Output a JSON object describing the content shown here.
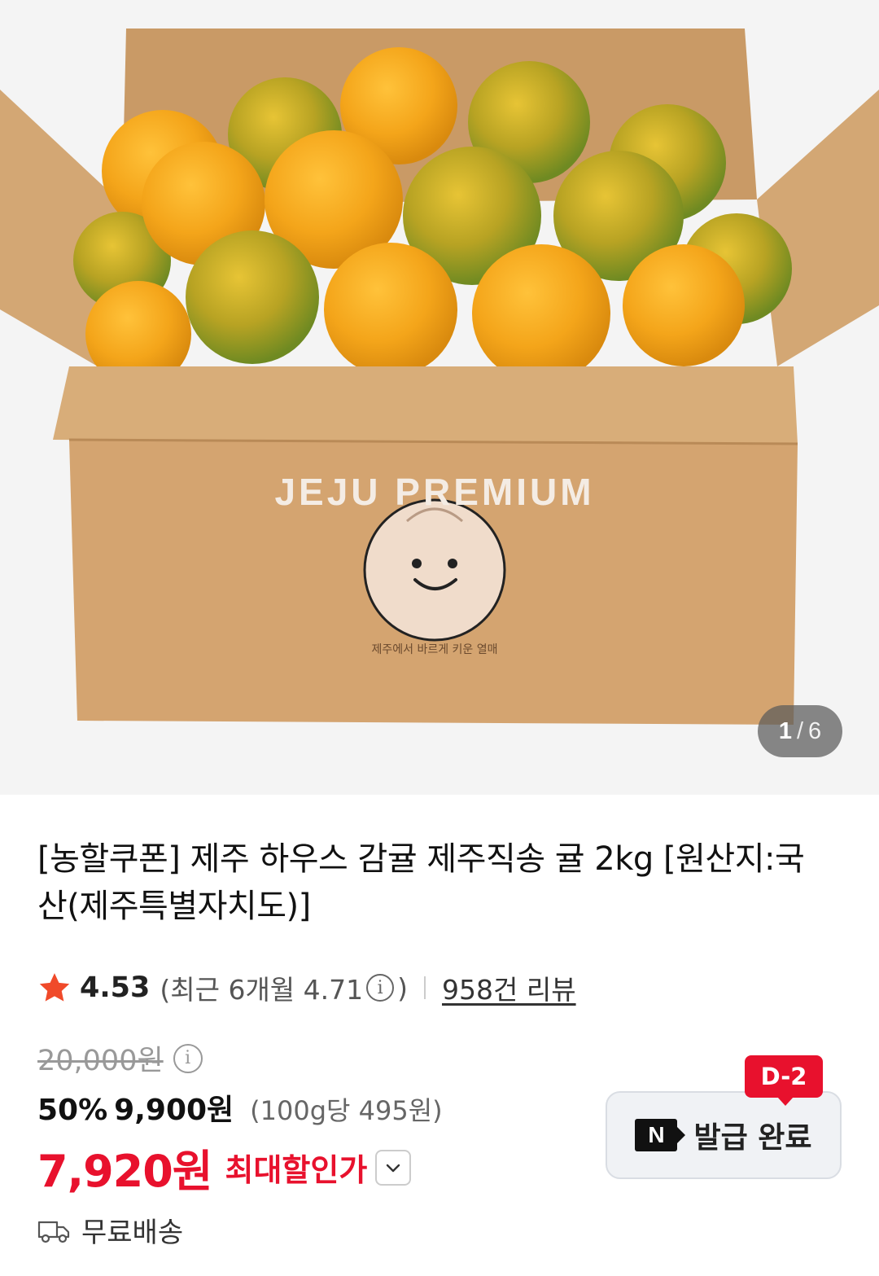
{
  "hero": {
    "box_brand": "JEJU PREMIUM",
    "box_tagline": "제주에서 바르게 키운 열매",
    "counter_current": "1",
    "counter_separator": "/",
    "counter_total": "6"
  },
  "product": {
    "title": "[농할쿠폰] 제주 하우스 감귤 제주직송 귤 2kg [원산지:국산(제주특별자치도)]",
    "rating": "4.53",
    "recent_prefix": "(최근 6개월 4.71",
    "recent_suffix": ")",
    "review_link": "958건 리뷰"
  },
  "price": {
    "original": "20,000원",
    "discount_rate": "50%",
    "sale_price": "9,900원",
    "unit_price": "(100g당 495원)",
    "max_price": "7,920원",
    "max_label": "최대할인가"
  },
  "coupon": {
    "logo": "N",
    "label": "발급 완료",
    "dday": "D-2"
  },
  "shipping": {
    "label": "무료배송"
  },
  "colors": {
    "accent_red": "#e8112d",
    "star": "#f04a2a"
  },
  "icons": [
    "star-icon",
    "info-icon",
    "chevron-down-icon",
    "truck-icon"
  ]
}
